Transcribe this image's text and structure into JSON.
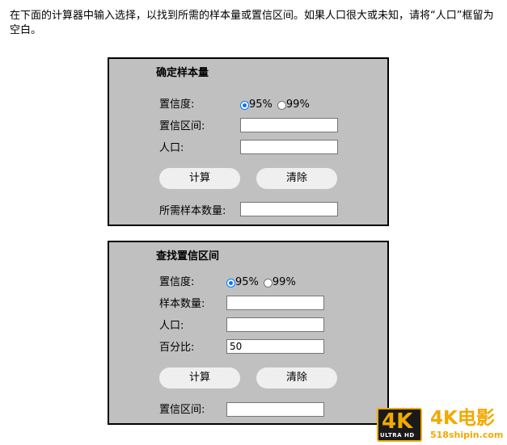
{
  "intro": "在下面的计算器中输入选择，以找到所需的样本量或置信区间。如果人口很大或未知，请将“人口”框留为空白。",
  "sample_size": {
    "title": "确定样本量",
    "confidence_label": "置信度:",
    "option_95": "95%",
    "option_99": "99%",
    "interval_label": "置信区间:",
    "interval_value": "",
    "population_label": "人口:",
    "population_value": "",
    "calculate_label": "计算",
    "clear_label": "清除",
    "result_label": "所需样本数量:",
    "result_value": ""
  },
  "confidence_interval": {
    "title": "查找置信区间",
    "confidence_label": "置信度:",
    "option_95": "95%",
    "option_99": "99%",
    "sample_label": "样本数量:",
    "sample_value": "",
    "population_label": "人口:",
    "population_value": "",
    "percent_label": "百分比:",
    "percent_value": "50",
    "calculate_label": "计算",
    "clear_label": "清除",
    "result_label": "置信区间:",
    "result_value": ""
  },
  "watermark": {
    "badge": "4K",
    "badge_sub": "ULTRA HD",
    "title": "4K电影",
    "site": "518shipin.com"
  }
}
